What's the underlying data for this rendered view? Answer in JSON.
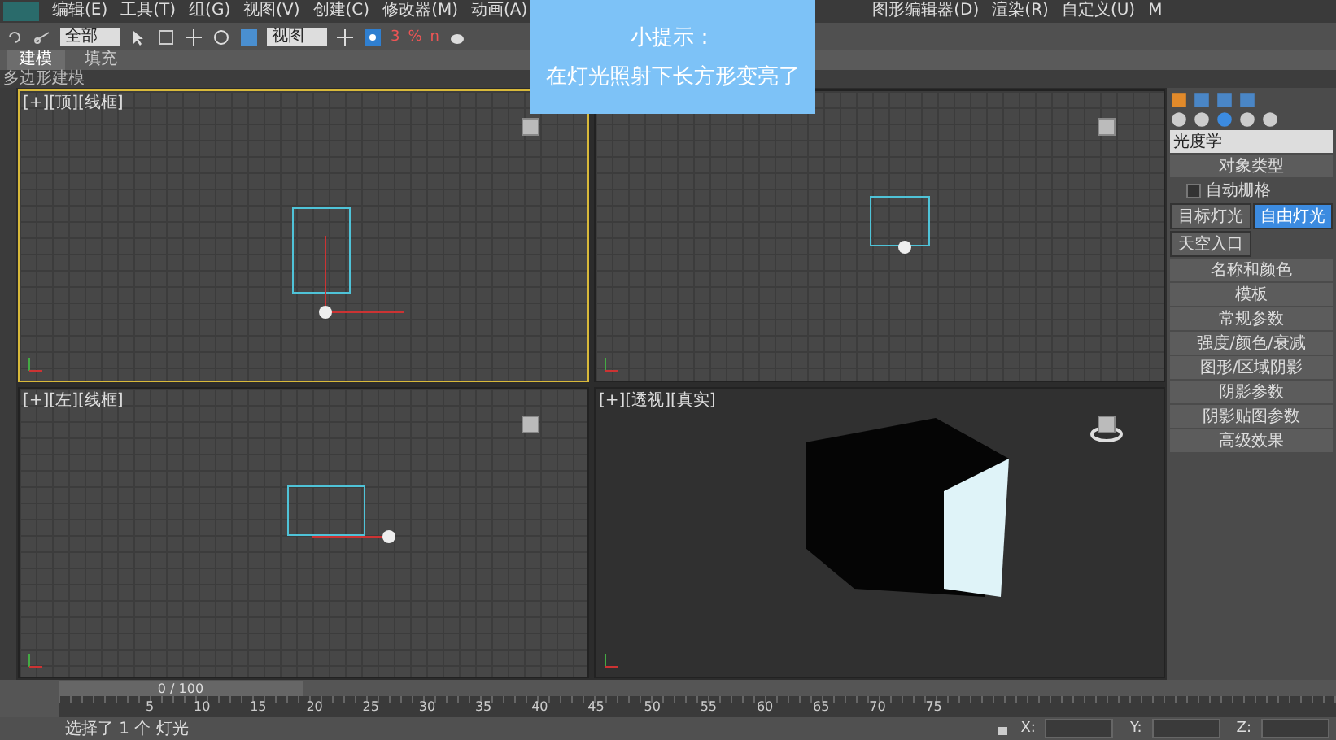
{
  "menu": [
    "编辑(E)",
    "工具(T)",
    "组(G)",
    "视图(V)",
    "创建(C)",
    "修改器(M)",
    "动画(A)",
    "图形编辑器(D)",
    "渲染(R)",
    "自定义(U)",
    "M"
  ],
  "toolbar": {
    "selection_filter": "全部",
    "reference": "视图",
    "snap_labels": [
      "3",
      "%",
      "n"
    ]
  },
  "ribbon": {
    "tabs": [
      {
        "label": "建模",
        "selected": true
      },
      {
        "label": "填充",
        "selected": false
      }
    ],
    "subtitle": "多边形建模"
  },
  "tip": {
    "title": "小提示：",
    "text": "在灯光照射下长方形变亮了"
  },
  "viewports": [
    {
      "kind": "top",
      "label": "[+][顶][线框]",
      "active": true
    },
    {
      "kind": "front",
      "active": false
    },
    {
      "kind": "left",
      "label": "[+][左][线框]",
      "active": false
    },
    {
      "kind": "perspective",
      "label": "[+][透视][真实]",
      "active": false
    }
  ],
  "command_panel": {
    "category": "光度学",
    "rollout_title": "对象类型",
    "autogrid": {
      "label": "自动栅格",
      "checked": false
    },
    "buttons": [
      {
        "label": "目标灯光",
        "selected": false
      },
      {
        "label": "自由灯光",
        "selected": true
      },
      {
        "label": "天空入口",
        "selected": false
      }
    ],
    "rollouts": [
      "名称和颜色",
      "模板",
      "常规参数",
      "强度/颜色/衰减",
      "图形/区域阴影",
      "阴影参数",
      "阴影贴图参数",
      "高级效果"
    ]
  },
  "timeline": {
    "frame": "0 / 100",
    "ticks": [
      "5",
      "10",
      "15",
      "20",
      "25",
      "30",
      "35",
      "40",
      "45",
      "50",
      "55",
      "60",
      "65",
      "70",
      "75"
    ]
  },
  "status": {
    "message": "选择了 1 个 灯光",
    "coords": [
      "X:",
      "Y:",
      "Z:"
    ]
  }
}
